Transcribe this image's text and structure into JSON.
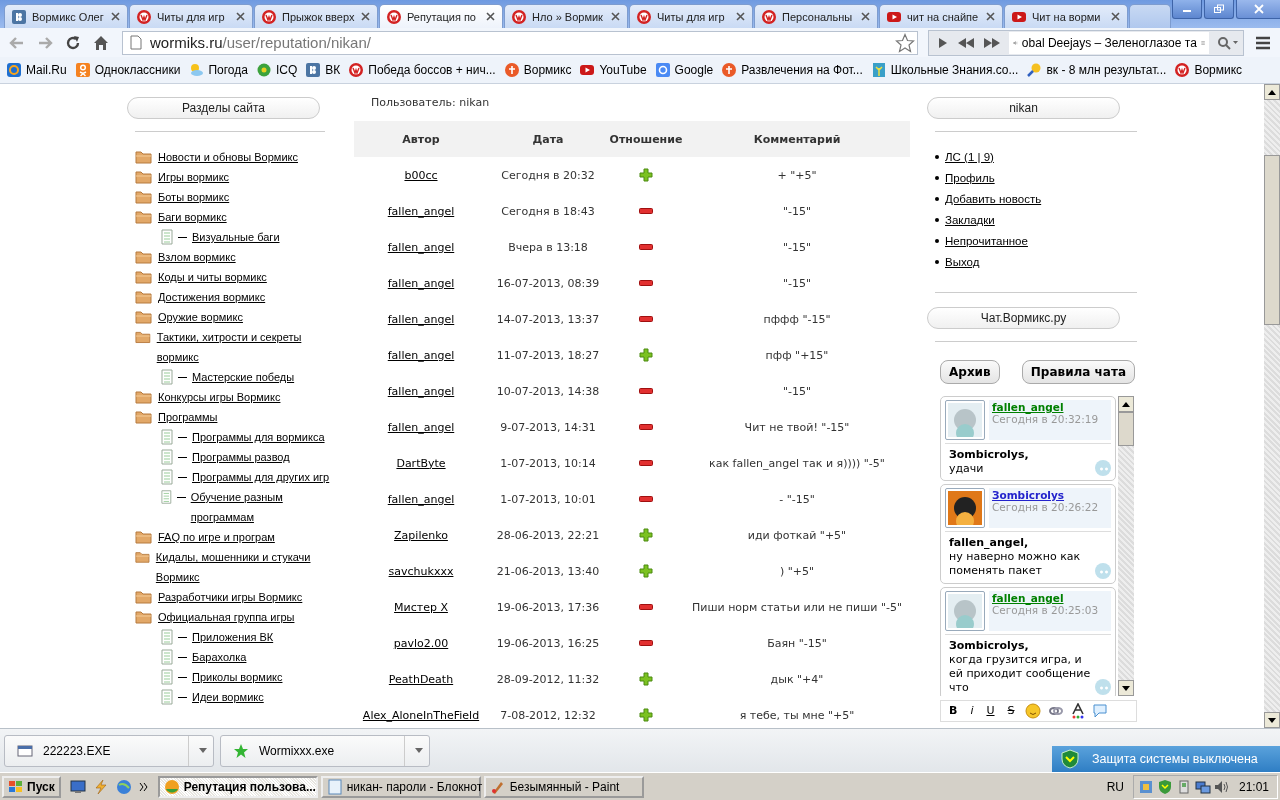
{
  "tabs": [
    {
      "label": "Вормикс Олег",
      "kind": "vk",
      "selected": false
    },
    {
      "label": "Читы для игр",
      "kind": "wormix",
      "selected": false
    },
    {
      "label": "Прыжок вверх",
      "kind": "wormix",
      "selected": false
    },
    {
      "label": "Репутация по",
      "kind": "wormix",
      "selected": true
    },
    {
      "label": "Нло » Вормик",
      "kind": "wormix",
      "selected": false
    },
    {
      "label": "Читы для игр",
      "kind": "wormix",
      "selected": false
    },
    {
      "label": "Персональны",
      "kind": "wormix",
      "selected": false
    },
    {
      "label": "чит на снайпе",
      "kind": "youtube",
      "selected": false
    },
    {
      "label": "Чит на ворми",
      "kind": "youtube",
      "selected": false
    }
  ],
  "toolbar": {
    "url_host": "wormiks.ru",
    "url_path": "/user/reputation/nikan/",
    "track": "obal Deejays – Зеленоглазое та"
  },
  "bookmarks": [
    {
      "label": "Mail.Ru",
      "kind": "mail"
    },
    {
      "label": "Одноклассники",
      "kind": "ok"
    },
    {
      "label": "Погода",
      "kind": "weather"
    },
    {
      "label": "ICQ",
      "kind": "icq"
    },
    {
      "label": "ВК",
      "kind": "vk"
    },
    {
      "label": "Победа боссов + нич...",
      "kind": "wormix"
    },
    {
      "label": "Вормикс",
      "kind": "f"
    },
    {
      "label": "YouTube",
      "kind": "youtube"
    },
    {
      "label": "Google",
      "kind": "google"
    },
    {
      "label": "Развлечения на Фот...",
      "kind": "f"
    },
    {
      "label": "Школьные Знания.co...",
      "kind": "school"
    },
    {
      "label": "вк - 8 млн результат...",
      "kind": "search"
    },
    {
      "label": "Вормикс",
      "kind": "wormix"
    }
  ],
  "sidebar": {
    "title": "Разделы сайта",
    "items": [
      {
        "label": "Новости и обновы Вормикс"
      },
      {
        "label": "Игры вормикс"
      },
      {
        "label": "Боты вормикс"
      },
      {
        "label": "Баги вормикс",
        "children": [
          {
            "label": "Визуальные баги"
          }
        ]
      },
      {
        "label": "Взлом вормикс"
      },
      {
        "label": "Коды и читы вормикс"
      },
      {
        "label": "Достижения вормикс"
      },
      {
        "label": "Оружие вормикс"
      },
      {
        "label": "Тактики, хитрости и секреты вормикс",
        "children": [
          {
            "label": "Мастерские победы"
          }
        ]
      },
      {
        "label": "Конкурсы игры Вормикс"
      },
      {
        "label": "Программы",
        "children": [
          {
            "label": "Программы для вормикса"
          },
          {
            "label": "Программы развод"
          },
          {
            "label": "Программы для других игр"
          },
          {
            "label": "Обучение разным программам"
          }
        ]
      },
      {
        "label": "FAQ по игре и програм"
      },
      {
        "label": "Кидалы, мошенники и стукачи Вормикс"
      },
      {
        "label": "Разработчики игры Вормикс"
      },
      {
        "label": "Официальная группа игры",
        "children": [
          {
            "label": "Приложения ВК"
          },
          {
            "label": "Барахолка"
          },
          {
            "label": "Приколы вормикс"
          },
          {
            "label": "Идеи вормикс"
          }
        ]
      }
    ]
  },
  "user_line": "Пользователь: nikan",
  "table": {
    "columns": [
      "Автор",
      "Дата",
      "Отношение",
      "Комментарий"
    ],
    "rows": [
      {
        "author": "b00cc",
        "date": "Сегодня в 20:32",
        "kind": "plus",
        "comment": "+ \"+5\""
      },
      {
        "author": "fallen_angel",
        "date": "Сегодня в 18:43",
        "kind": "minus",
        "comment": "\"-15\""
      },
      {
        "author": "fallen_angel",
        "date": "Вчера в 13:18",
        "kind": "minus",
        "comment": "\"-15\""
      },
      {
        "author": "fallen_angel",
        "date": "16-07-2013, 08:39",
        "kind": "minus",
        "comment": "\"-15\""
      },
      {
        "author": "fallen_angel",
        "date": "14-07-2013, 13:37",
        "kind": "minus",
        "comment": "пффф \"-15\""
      },
      {
        "author": "fallen_angel",
        "date": "11-07-2013, 18:27",
        "kind": "plus",
        "comment": "пфф \"+15\""
      },
      {
        "author": "fallen_angel",
        "date": "10-07-2013, 14:38",
        "kind": "minus",
        "comment": "\"-15\""
      },
      {
        "author": "fallen_angel",
        "date": "9-07-2013, 14:31",
        "kind": "minus",
        "comment": "Чит не твой! \"-15\""
      },
      {
        "author": "DartByte",
        "date": "1-07-2013, 10:14",
        "kind": "minus",
        "comment": "как fallen_angel так и я)))) \"-5\""
      },
      {
        "author": "fallen_angel",
        "date": "1-07-2013, 10:01",
        "kind": "minus",
        "comment": "- \"-15\""
      },
      {
        "author": "Zapilenko",
        "date": "28-06-2013, 22:21",
        "kind": "plus",
        "comment": "иди фоткай \"+5\""
      },
      {
        "author": "savchukxxx",
        "date": "21-06-2013, 13:40",
        "kind": "plus",
        "comment": ") \"+5\""
      },
      {
        "author": "Мистер Х",
        "date": "19-06-2013, 17:36",
        "kind": "minus",
        "comment": "Пиши норм статьи или не пиши \"-5\""
      },
      {
        "author": "pavlo2.00",
        "date": "19-06-2013, 16:25",
        "kind": "minus",
        "comment": "Баян \"-15\""
      },
      {
        "author": "PeathDeath",
        "date": "28-09-2012, 11:32",
        "kind": "plus",
        "comment": "дык \"+4\""
      },
      {
        "author": "Alex_AloneInTheField",
        "date": "7-08-2012, 12:32",
        "kind": "plus",
        "comment": "я тебе, ты мне \"+5\""
      }
    ]
  },
  "user_panel": {
    "title": "nikan",
    "links": [
      "ЛС (1 | 9)",
      "Профиль",
      "Добавить новость",
      "Закладки",
      "Непрочитанное",
      "Выход"
    ]
  },
  "chat": {
    "title": "Чат.Вормикс.ру",
    "buttons": [
      "Архив",
      "Правила чата"
    ],
    "messages": [
      {
        "author": "fallen_angel",
        "color": "#008000",
        "kind": "grey",
        "time": "Сегодня в 20:32:19",
        "addressee": "Зombicrolys,",
        "text": "удачи"
      },
      {
        "author": "Зombicrolys",
        "color": "#2222cc",
        "kind": "orange",
        "time": "Сегодня в 20:26:22",
        "addressee": "fallen_angel,",
        "text": "ну наверно можно как поменять пакет"
      },
      {
        "author": "fallen_angel",
        "color": "#008000",
        "kind": "grey",
        "time": "Сегодня в 20:25:03",
        "addressee": "Зombicrolys,",
        "text": "когда грузится игра, и ей приходит сообщение что"
      }
    ],
    "format_buttons": [
      "B",
      "i",
      "U",
      "S"
    ]
  },
  "downloads": [
    {
      "name": "222223.EXE",
      "kind": "exe"
    },
    {
      "name": "Wormixxx.exe",
      "kind": "star"
    }
  ],
  "taskbar": {
    "start": "Пуск",
    "tasks": [
      {
        "label": "Репутация пользова...",
        "kind": "browser",
        "selected": true
      },
      {
        "label": "никан- пароли - Блокнот",
        "kind": "notepad",
        "selected": false
      },
      {
        "label": "Безымянный - Paint",
        "kind": "paint",
        "selected": false
      }
    ],
    "language": "RU",
    "clock": "21:01",
    "notification": "Защита системы выключена"
  }
}
